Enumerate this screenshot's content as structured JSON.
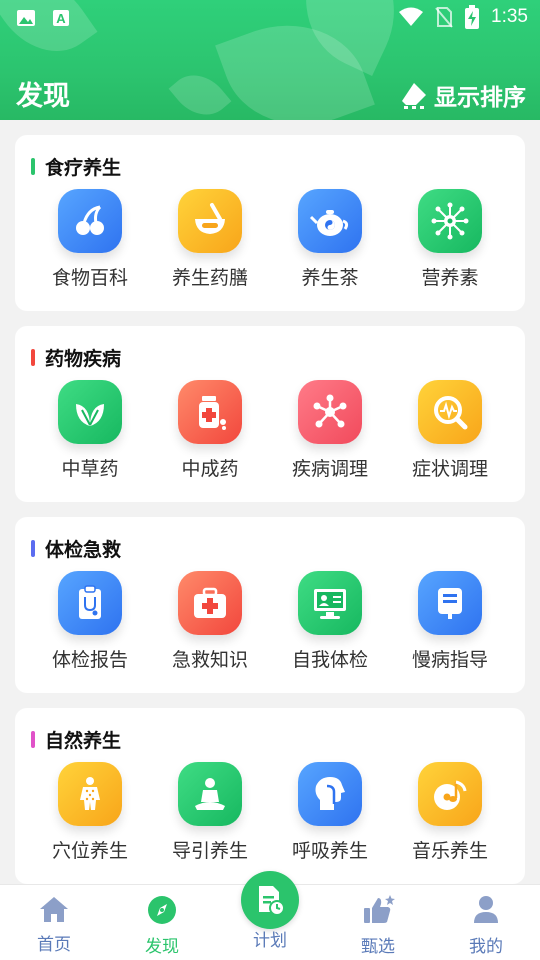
{
  "status_bar": {
    "time": "1:35"
  },
  "header": {
    "title": "发现",
    "sort_label": "显示排序"
  },
  "sections": [
    {
      "title": "食疗养生",
      "accent": "#2bc46c",
      "items": [
        {
          "label": "食物百科",
          "icon": "cherry-icon"
        },
        {
          "label": "养生药膳",
          "icon": "mortar-icon"
        },
        {
          "label": "养生茶",
          "icon": "teapot-icon"
        },
        {
          "label": "营养素",
          "icon": "molecule-icon"
        }
      ]
    },
    {
      "title": "药物疾病",
      "accent": "#f2473d",
      "items": [
        {
          "label": "中草药",
          "icon": "herb-leaf-icon"
        },
        {
          "label": "中成药",
          "icon": "medicine-bottle-icon"
        },
        {
          "label": "疾病调理",
          "icon": "virus-icon"
        },
        {
          "label": "症状调理",
          "icon": "symptom-search-icon"
        }
      ]
    },
    {
      "title": "体检急救",
      "accent": "#5b6cf0",
      "items": [
        {
          "label": "体检报告",
          "icon": "clipboard-icon"
        },
        {
          "label": "急救知识",
          "icon": "first-aid-kit-icon"
        },
        {
          "label": "自我体检",
          "icon": "monitor-icon"
        },
        {
          "label": "慢病指导",
          "icon": "iv-bag-icon"
        }
      ]
    },
    {
      "title": "自然养生",
      "accent": "#e052c8",
      "items": [
        {
          "label": "穴位养生",
          "icon": "body-points-icon"
        },
        {
          "label": "导引养生",
          "icon": "meditation-icon"
        },
        {
          "label": "呼吸养生",
          "icon": "head-profile-icon"
        },
        {
          "label": "音乐养生",
          "icon": "music-disc-icon"
        }
      ]
    }
  ],
  "tabbar": [
    {
      "label": "首页",
      "icon": "home-icon"
    },
    {
      "label": "发现",
      "icon": "compass-icon",
      "active": true
    },
    {
      "label": "计划",
      "icon": "plan-icon"
    },
    {
      "label": "甄选",
      "icon": "thumbs-up-icon"
    },
    {
      "label": "我的",
      "icon": "user-icon"
    }
  ]
}
